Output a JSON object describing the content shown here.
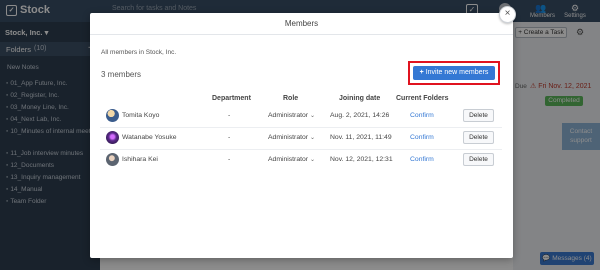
{
  "app": {
    "name": "Stock",
    "search_placeholder": "Search for tasks and Notes"
  },
  "topbar": {
    "badge": "1",
    "members_label": "Members",
    "settings_label": "Settings"
  },
  "sidebar": {
    "workspace": "Stock, Inc.",
    "folders_label": "Folders",
    "folders_count": "(10)",
    "new_notes": "New Notes",
    "items": [
      "01_App Future, Inc.",
      "02_Register, Inc.",
      "03_Money Line, Inc.",
      "04_Next Lab, Inc.",
      "10_Minutes of internal meeting",
      "11_Job interview minutes",
      "12_Documents",
      "13_Inquiry management",
      "14_Manual",
      "Team Folder"
    ]
  },
  "background": {
    "create_task": "+ Create a Task",
    "due_label": "Due",
    "due_date": "Fri Nov. 12, 2021",
    "completed": "Completed",
    "contact_support": "Contact support",
    "messages": "Messages (4)"
  },
  "modal": {
    "title": "Members",
    "subtitle": "All members in Stock, Inc.",
    "member_count": "3 members",
    "invite_button": "Invite new members",
    "columns": {
      "department": "Department",
      "role": "Role",
      "joining_date": "Joining date",
      "current_folders": "Current Folders"
    },
    "members": [
      {
        "name": "Tomita Koyo",
        "department": "-",
        "role": "Administrator",
        "joining_date": "Aug. 2, 2021, 14:26",
        "folders": "Confirm",
        "delete": "Delete"
      },
      {
        "name": "Watanabe Yosuke",
        "department": "-",
        "role": "Administrator",
        "joining_date": "Nov. 11, 2021, 11:49",
        "folders": "Confirm",
        "delete": "Delete"
      },
      {
        "name": "Ishihara Kei",
        "department": "-",
        "role": "Administrator",
        "joining_date": "Nov. 12, 2021, 12:31",
        "folders": "Confirm",
        "delete": "Delete"
      }
    ]
  },
  "colors": {
    "accent": "#3478d4",
    "highlight": "#e0131f",
    "sidebar": "#2e3e50",
    "topbar": "#3a4f66"
  }
}
